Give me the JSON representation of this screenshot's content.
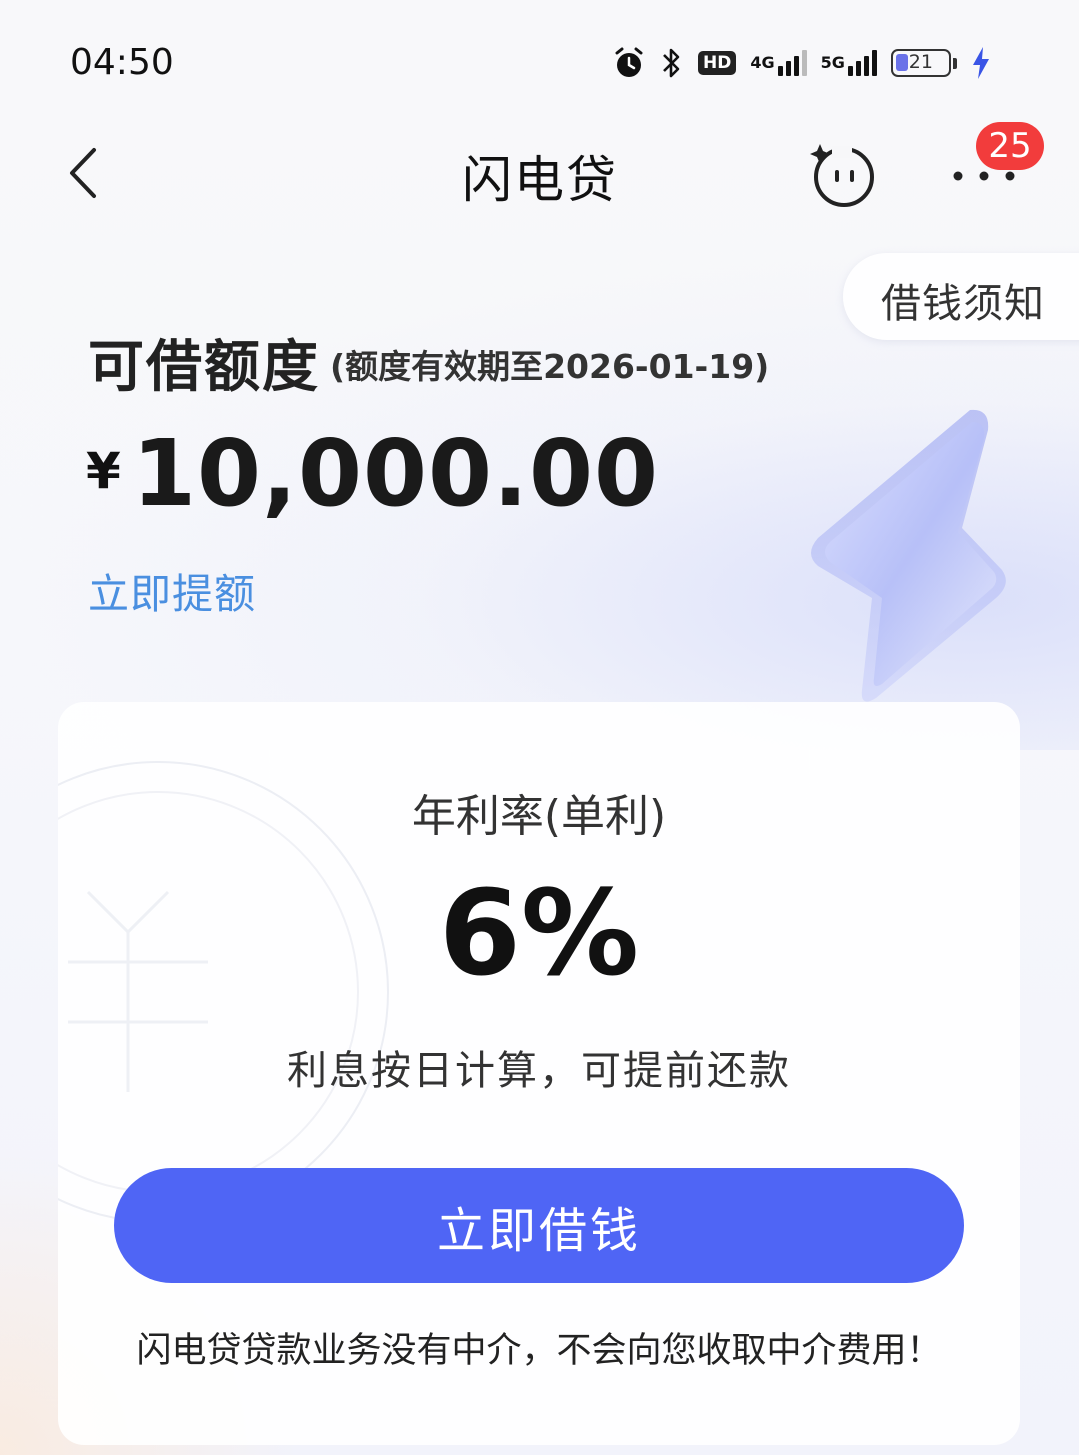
{
  "status_bar": {
    "time": "04:50",
    "icons": [
      "alarm-icon",
      "bluetooth-icon",
      "hd-voice-icon",
      "signal-4g-icon",
      "signal-5g-icon",
      "battery-icon",
      "charging-icon"
    ],
    "hd_label": "HD",
    "net1_label": "4G",
    "net2_label": "5G",
    "battery_level": "21"
  },
  "header": {
    "title": "闪电贷",
    "back_icon": "chevron-left-icon",
    "assistant_icon": "robot-face-icon",
    "more_icon": "more-dots-icon",
    "notification_count": "25"
  },
  "notice_button": {
    "label": "借钱须知"
  },
  "credit": {
    "title": "可借额度",
    "validity": "(额度有效期至2026-01-19)",
    "currency": "¥",
    "amount": "10,000.00",
    "raise_link": "立即提额"
  },
  "rate_card": {
    "label": "年利率(单利)",
    "value": "6%",
    "note": "利息按日计算，可提前还款",
    "borrow_button": "立即借钱",
    "disclaimer": "闪电贷贷款业务没有中介，不会向您收取中介费用！"
  },
  "colors": {
    "primary_button": "#4f65f5",
    "link": "#4a8fe0",
    "badge": "#f23c3c",
    "battery_fill": "#6a72e8",
    "charging": "#3a55e6"
  }
}
